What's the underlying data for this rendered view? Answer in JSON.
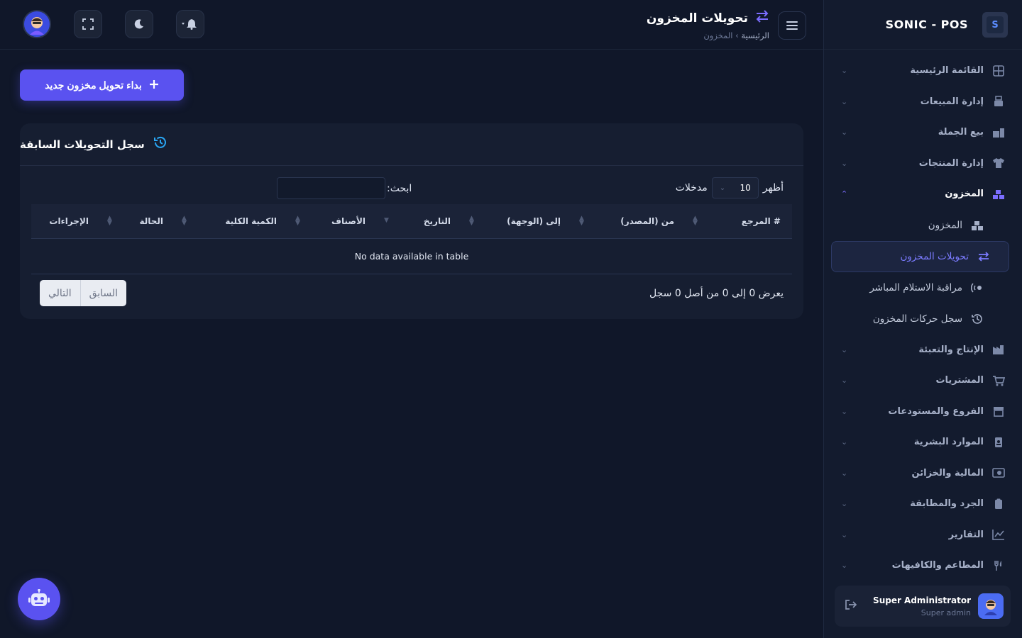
{
  "brand": {
    "name": "SONIC - POS"
  },
  "sidebar": {
    "items": [
      {
        "label": "القائمة الرئيسية",
        "icon": "dashboard-icon"
      },
      {
        "label": "إدارة المبيعات",
        "icon": "sales-icon"
      },
      {
        "label": "بيع الجملة",
        "icon": "wholesale-icon"
      },
      {
        "label": "إدارة المنتجات",
        "icon": "shirt-icon"
      },
      {
        "label": "المخزون",
        "icon": "boxes-icon"
      }
    ],
    "sub_items": [
      {
        "label": "المخزون",
        "icon": "boxes-icon"
      },
      {
        "label": "تحويلات المخزون",
        "icon": "transfer-icon"
      },
      {
        "label": "مراقبة الاستلام المباشر",
        "icon": "satellite-icon"
      },
      {
        "label": "سجل حركات المخزون",
        "icon": "history-icon"
      }
    ],
    "items_after": [
      {
        "label": "الإنتاج والتعبئة",
        "icon": "factory-icon"
      },
      {
        "label": "المشتريات",
        "icon": "cart-icon"
      },
      {
        "label": "الفروع والمستودعات",
        "icon": "store-icon"
      },
      {
        "label": "الموارد البشرية",
        "icon": "id-badge-icon"
      },
      {
        "label": "المالية والخزائن",
        "icon": "money-icon"
      },
      {
        "label": "الجرد والمطابقة",
        "icon": "clipboard-icon"
      },
      {
        "label": "التقارير",
        "icon": "chart-line-icon"
      },
      {
        "label": "المطاعم والكافيهات",
        "icon": "utensils-icon"
      }
    ]
  },
  "user": {
    "name": "Super Administrator",
    "role": "Super admin"
  },
  "header": {
    "title": "تحويلات المخزون",
    "breadcrumb_home": "الرئيسية",
    "breadcrumb_sep": "›",
    "breadcrumb_current": "المخزون"
  },
  "main": {
    "new_button": "بداء تحويل مخزون جديد",
    "card_title": "سجل التحويلات السابقة",
    "show_label": "أظهر",
    "entries_value": "10",
    "entries_label": "مدخلات",
    "search_label": "ابحث:",
    "columns": [
      "# المرجع",
      "من (المصدر)",
      "إلى (الوجهة)",
      "التاريخ",
      "الأصناف",
      "الكمية الكلية",
      "الحالة",
      "الإجراءات"
    ],
    "empty_text": "No data available in table",
    "info_text": "يعرض 0 إلى 0 من أصل 0 سجل",
    "prev_label": "السابق",
    "next_label": "التالي"
  },
  "colors": {
    "accent": "#5a52f0",
    "bg": "#101729",
    "card": "#161e31",
    "info_icon": "#29a7f5"
  }
}
